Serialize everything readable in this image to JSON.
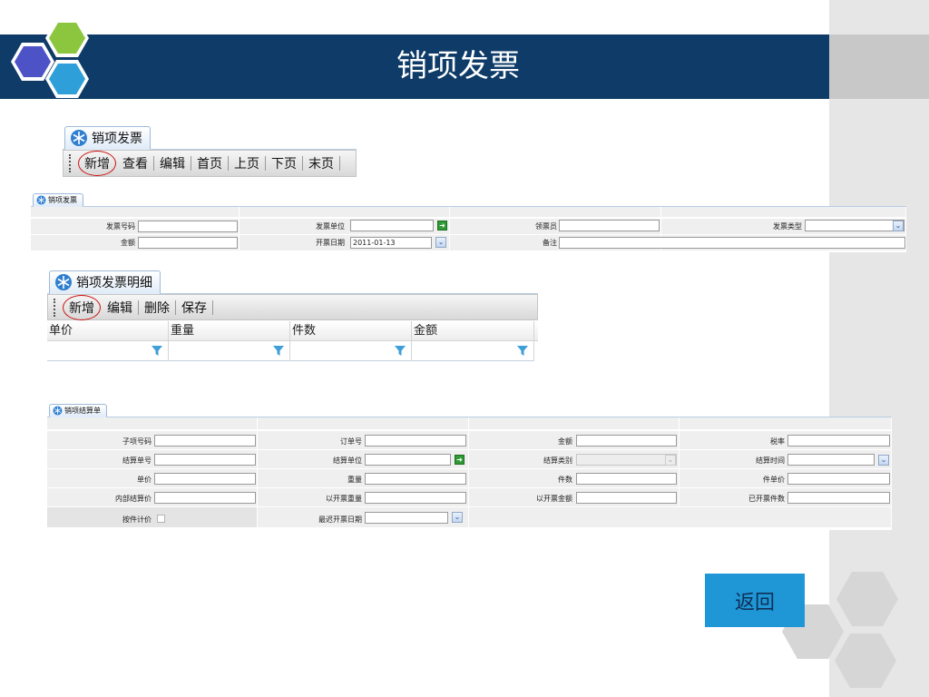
{
  "slide": {
    "title": "销项发票",
    "back_label": "返回"
  },
  "colors": {
    "title_band": "#0e3b67",
    "back_button": "#1f97d6",
    "hex_green": "#8cc63f",
    "hex_blue": "#2e9fd8",
    "hex_indigo": "#4d53c7"
  },
  "top_panel": {
    "tab": "销项发票",
    "buttons": [
      "新增",
      "查看",
      "编辑",
      "首页",
      "上页",
      "下页",
      "末页"
    ]
  },
  "invoice_form": {
    "tab": "销项发票",
    "fields": {
      "invoice_no_label": "发票号码",
      "invoice_no_value": "",
      "unit_label": "发票单位",
      "unit_value": "",
      "collector_label": "领票员",
      "collector_value": "",
      "type_label": "发票类型",
      "type_value": "",
      "amount_label": "金额",
      "amount_value": "",
      "date_label": "开票日期",
      "date_value": "2011-01-13",
      "remark_label": "备注",
      "remark_value": ""
    }
  },
  "detail_panel": {
    "tab": "销项发票明细",
    "buttons": [
      "新增",
      "编辑",
      "删除",
      "保存"
    ],
    "columns": [
      "单价",
      "重量",
      "件数",
      "金额"
    ]
  },
  "settlement_form": {
    "tab": "销项结算单",
    "labels": {
      "sub_no": "子项号码",
      "order_no": "订单号",
      "amount": "金额",
      "tax_rate": "税率",
      "settle_no": "结算单号",
      "settle_unit": "结算单位",
      "settle_type": "结算类别",
      "settle_time": "结算时间",
      "unit_price": "单价",
      "weight": "重量",
      "pieces": "件数",
      "piece_price": "件单价",
      "internal_price": "内部结算价",
      "billed_weight": "以开票重量",
      "billed_amount": "以开票金额",
      "billed_pieces": "已开票件数",
      "by_piece": "按件计价",
      "last_bill_date": "最迟开票日期"
    }
  }
}
